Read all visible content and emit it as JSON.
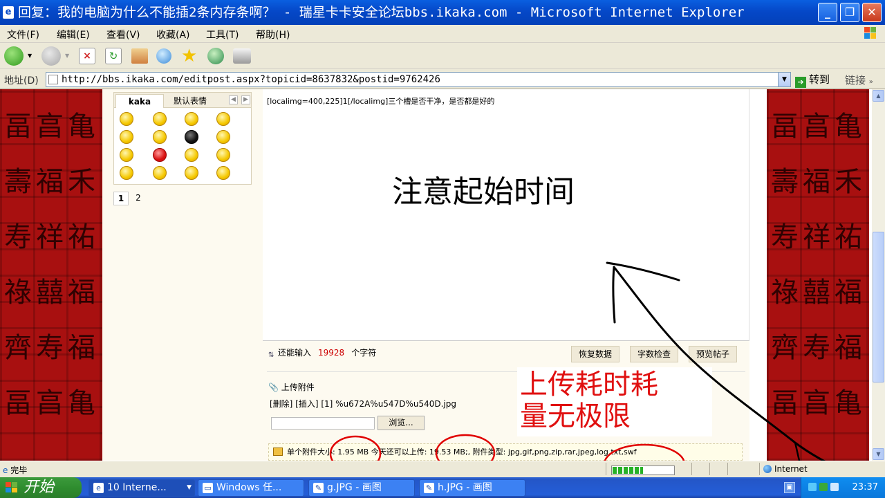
{
  "window": {
    "title": "回复：我的电脑为什么不能插2条内存条啊？ - 瑞星卡卡安全论坛bbs.ikaka.com - Microsoft Internet Explorer",
    "minimize": "_",
    "maximize": "❐",
    "close": "✕"
  },
  "menu": [
    "文件(F)",
    "编辑(E)",
    "查看(V)",
    "收藏(A)",
    "工具(T)",
    "帮助(H)"
  ],
  "address": {
    "label": "地址(D)",
    "url": "http://bbs.ikaka.com/editpost.aspx?topicid=8637832&postid=9762426",
    "go": "转到",
    "links": "链接"
  },
  "smilies": {
    "tab_active": "kaka",
    "tab_other": "默认表情",
    "pages": [
      "1",
      "2"
    ]
  },
  "editor": {
    "content": "[localimg=400,225]1[/localimg]三个槽是否干净，是否都是好的",
    "annotation": "注意起始时间"
  },
  "counter": {
    "prefix": "还能输入",
    "value": "19928",
    "suffix": "个字符"
  },
  "buttons": {
    "restore": "恢复数据",
    "wordcount": "字数检查",
    "preview": "预览帖子"
  },
  "upload": {
    "title": "上传附件",
    "file_line": "[删除] [插入] [1] %u672A%u547D%u540D.jpg",
    "browse": "浏览...",
    "info": "单个附件大小: 1.95 MB 今天还可以上传: 19.53 MB;, 附件类型: jpg,gif,png,zip,rar,jpeg,log,txt,swf",
    "progress": 0.5
  },
  "annotation2": {
    "line1": "上传耗时耗",
    "line2": "量无极限"
  },
  "status": {
    "text": "完毕",
    "zone": "Internet"
  },
  "taskbar": {
    "start": "开始",
    "tasks": [
      "10 Interne...",
      "Windows 任...",
      "g.JPG - 画图",
      "h.JPG - 画图"
    ],
    "clock": "23:37"
  },
  "colors": {
    "accent": "#0548c8",
    "annotation_red": "#e01010",
    "counter_red": "#cc0000",
    "progress_green": "#27b127"
  }
}
